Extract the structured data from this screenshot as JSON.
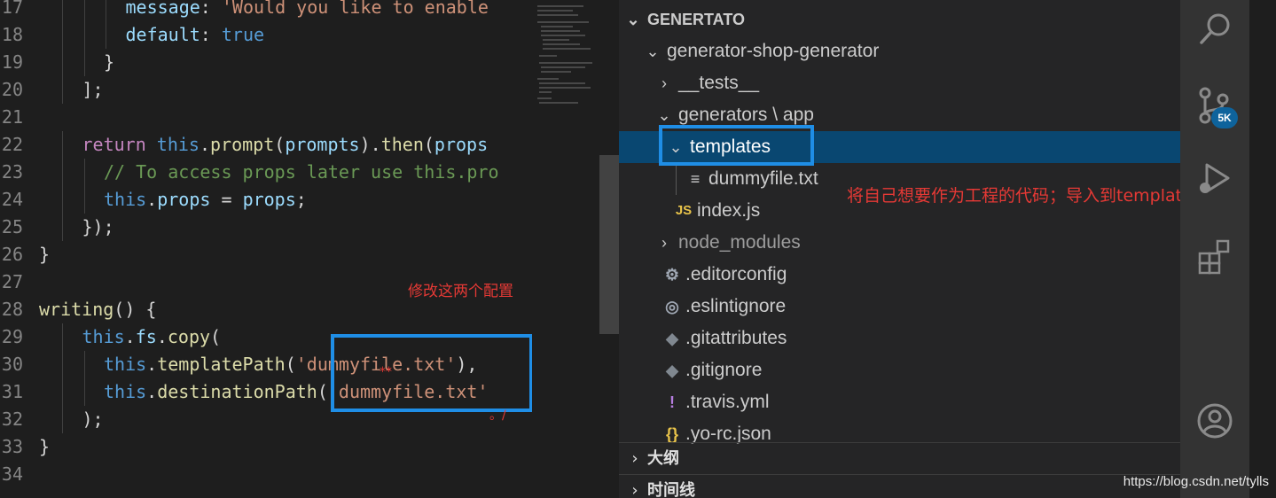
{
  "editor": {
    "lines": [
      {
        "num": "17",
        "indent": 3,
        "tokens": [
          [
            "prop",
            "message"
          ],
          [
            "p",
            ": "
          ],
          [
            "str",
            "'Would you like to enable"
          ]
        ]
      },
      {
        "num": "18",
        "indent": 3,
        "tokens": [
          [
            "prop",
            "default"
          ],
          [
            "p",
            ": "
          ],
          [
            "bool",
            "true"
          ]
        ]
      },
      {
        "num": "19",
        "indent": 2,
        "tokens": [
          [
            "p",
            "}"
          ]
        ]
      },
      {
        "num": "20",
        "indent": 1,
        "tokens": [
          [
            "p",
            "];"
          ]
        ]
      },
      {
        "num": "21",
        "indent": 0,
        "tokens": []
      },
      {
        "num": "22",
        "indent": 1,
        "tokens": [
          [
            "kw",
            "return "
          ],
          [
            "this",
            "this"
          ],
          [
            "p",
            "."
          ],
          [
            "fn",
            "prompt"
          ],
          [
            "p",
            "("
          ],
          [
            "var",
            "prompts"
          ],
          [
            "p",
            ")."
          ],
          [
            "fn",
            "then"
          ],
          [
            "p",
            "("
          ],
          [
            "var",
            "props"
          ]
        ]
      },
      {
        "num": "23",
        "indent": 2,
        "tokens": [
          [
            "cm",
            "// To access props later use this.pro"
          ]
        ]
      },
      {
        "num": "24",
        "indent": 2,
        "tokens": [
          [
            "this",
            "this"
          ],
          [
            "p",
            "."
          ],
          [
            "prop",
            "props"
          ],
          [
            "p",
            " = "
          ],
          [
            "var",
            "props"
          ],
          [
            "p",
            ";"
          ]
        ]
      },
      {
        "num": "25",
        "indent": 1,
        "tokens": [
          [
            "p",
            "});"
          ]
        ]
      },
      {
        "num": "26",
        "indent": 0,
        "tokens": [
          [
            "p",
            "}"
          ]
        ]
      },
      {
        "num": "27",
        "indent": 0,
        "tokens": []
      },
      {
        "num": "28",
        "indent": 0,
        "tokens": [
          [
            "fn",
            "writing"
          ],
          [
            "p",
            "() {"
          ]
        ]
      },
      {
        "num": "29",
        "indent": 1,
        "tokens": [
          [
            "this",
            "this"
          ],
          [
            "p",
            "."
          ],
          [
            "prop",
            "fs"
          ],
          [
            "p",
            "."
          ],
          [
            "fn",
            "copy"
          ],
          [
            "p",
            "("
          ]
        ]
      },
      {
        "num": "30",
        "indent": 2,
        "tokens": [
          [
            "this",
            "this"
          ],
          [
            "p",
            "."
          ],
          [
            "fn",
            "templatePath"
          ],
          [
            "p",
            "("
          ],
          [
            "str",
            "'dummyfile.txt'"
          ],
          [
            "p",
            "),"
          ]
        ]
      },
      {
        "num": "31",
        "indent": 2,
        "tokens": [
          [
            "this",
            "this"
          ],
          [
            "p",
            "."
          ],
          [
            "fn",
            "destinationPath"
          ],
          [
            "p",
            "("
          ],
          [
            "str",
            "'dummyfile.txt'"
          ]
        ]
      },
      {
        "num": "32",
        "indent": 1,
        "tokens": [
          [
            "p",
            ");"
          ]
        ]
      },
      {
        "num": "33",
        "indent": 0,
        "tokens": [
          [
            "p",
            "}"
          ]
        ]
      },
      {
        "num": "34",
        "indent": 0,
        "tokens": []
      }
    ],
    "annotation": "修改这两个配置"
  },
  "explorer": {
    "root_label": "GENERTATO",
    "items": [
      {
        "label": "generator-shop-generator",
        "chev": "open",
        "depth": 0,
        "icon": "",
        "dim": false
      },
      {
        "label": "__tests__",
        "chev": "closed",
        "depth": 1,
        "icon": "",
        "dim": false
      },
      {
        "label": "generators \\ app",
        "chev": "open",
        "depth": 1,
        "icon": "",
        "dim": false
      },
      {
        "label": "templates",
        "chev": "open",
        "depth": 2,
        "icon": "",
        "dim": false,
        "selected": true
      },
      {
        "label": "dummyfile.txt",
        "chev": "",
        "depth": 3,
        "icon": "text-file-icon",
        "dim": false
      },
      {
        "label": "index.js",
        "chev": "",
        "depth": 2,
        "icon": "js-file-icon",
        "dim": false
      },
      {
        "label": "node_modules",
        "chev": "closed",
        "depth": 1,
        "icon": "",
        "dim": true
      },
      {
        "label": ".editorconfig",
        "chev": "",
        "depth": 1,
        "icon": "gear-icon",
        "dim": false
      },
      {
        "label": ".eslintignore",
        "chev": "",
        "depth": 1,
        "icon": "eslint-icon",
        "dim": false
      },
      {
        "label": ".gitattributes",
        "chev": "",
        "depth": 1,
        "icon": "git-icon",
        "dim": false
      },
      {
        "label": ".gitignore",
        "chev": "",
        "depth": 1,
        "icon": "git-icon",
        "dim": false
      },
      {
        "label": ".travis.yml",
        "chev": "",
        "depth": 1,
        "icon": "exclamation-icon",
        "dim": false
      },
      {
        "label": ".yo-rc.json",
        "chev": "",
        "depth": 1,
        "icon": "json-braces-icon",
        "dim": false
      }
    ],
    "annotation": "将自己想要作为工程的代码；导入到templates中",
    "sections": [
      {
        "label": "大纲"
      },
      {
        "label": "时间线"
      }
    ]
  },
  "icon_glyphs": {
    "text-file-icon": "≡",
    "js-file-icon": "JS",
    "gear-icon": "⚙",
    "eslint-icon": "◎",
    "git-icon": "◆",
    "exclamation-icon": "!",
    "json-braces-icon": "{}"
  },
  "icon_colors": {
    "text-file-icon": "#cccccc",
    "js-file-icon": "#e8c34a",
    "gear-icon": "#a0a8b4",
    "eslint-icon": "#a0a8b4",
    "git-icon": "#808890",
    "exclamation-icon": "#b77ee0",
    "json-braces-icon": "#e8c34a"
  },
  "activity_bar": {
    "icons": [
      "search-icon",
      "source-control-icon",
      "run-debug-icon",
      "extensions-icon",
      "account-icon"
    ],
    "scm_badge": "5K"
  },
  "colors": {
    "accent_highlight": "#1f8ee6",
    "annotation_red": "#e53935",
    "selection": "#094771"
  },
  "watermark": "https://blog.csdn.net/tylls"
}
